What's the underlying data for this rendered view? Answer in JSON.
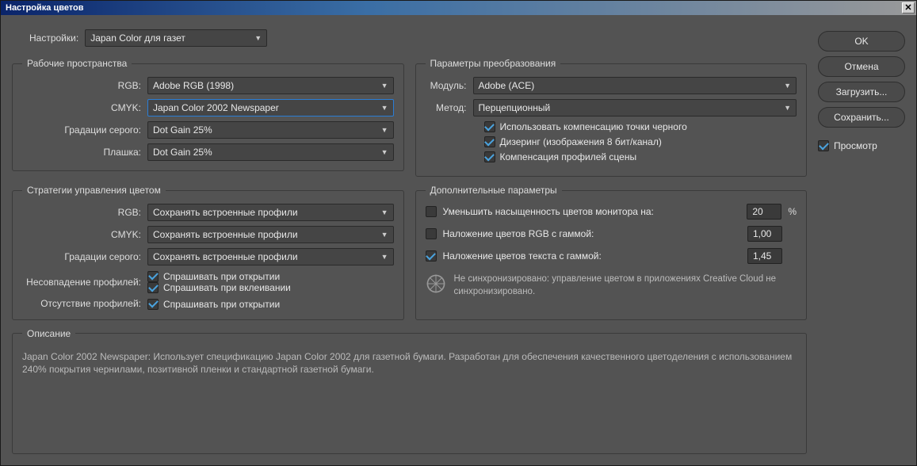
{
  "title": "Настройка цветов",
  "settings": {
    "label": "Настройки:",
    "value": "Japan Color для газет"
  },
  "workspaces": {
    "legend": "Рабочие пространства",
    "rgb_label": "RGB:",
    "rgb_value": "Adobe RGB (1998)",
    "cmyk_label": "CMYK:",
    "cmyk_value": "Japan Color 2002 Newspaper",
    "gray_label": "Градации серого:",
    "gray_value": "Dot Gain 25%",
    "spot_label": "Плашка:",
    "spot_value": "Dot Gain 25%"
  },
  "conversion": {
    "legend": "Параметры преобразования",
    "module_label": "Модуль:",
    "module_value": "Adobe (ACE)",
    "method_label": "Метод:",
    "method_value": "Перцепционный",
    "black_point": "Использовать компенсацию точки черного",
    "dithering": "Дизеринг (изображения 8 бит/канал)",
    "scene_profile": "Компенсация профилей сцены"
  },
  "policies": {
    "legend": "Стратегии управления цветом",
    "rgb_label": "RGB:",
    "rgb_value": "Сохранять встроенные профили",
    "cmyk_label": "CMYK:",
    "cmyk_value": "Сохранять встроенные профили",
    "gray_label": "Градации серого:",
    "gray_value": "Сохранять встроенные профили",
    "mismatch_label": "Несовпадение профилей:",
    "ask_open": "Спрашивать при открытии",
    "ask_paste": "Спрашивать при вклеивании",
    "missing_label": "Отсутствие профилей:"
  },
  "advanced": {
    "legend": "Дополнительные параметры",
    "desaturate": "Уменьшить насыщенность цветов монитора на:",
    "desaturate_value": "20",
    "desaturate_suffix": "%",
    "blend_rgb": "Наложение цветов RGB с гаммой:",
    "blend_rgb_value": "1,00",
    "blend_text": "Наложение цветов текста с гаммой:",
    "blend_text_value": "1,45"
  },
  "sync": {
    "text": "Не синхронизировано: управление цветом в приложениях Creative Cloud не синхронизировано."
  },
  "description": {
    "legend": "Описание",
    "text": "Japan Color 2002 Newspaper:  Использует спецификацию Japan Color 2002 для газетной бумаги. Разработан для обеспечения качественного цветоделения с использованием 240% покрытия чернилами, позитивной пленки и стандартной газетной бумаги."
  },
  "buttons": {
    "ok": "OK",
    "cancel": "Отмена",
    "load": "Загрузить...",
    "save": "Сохранить..."
  },
  "preview_label": "Просмотр"
}
